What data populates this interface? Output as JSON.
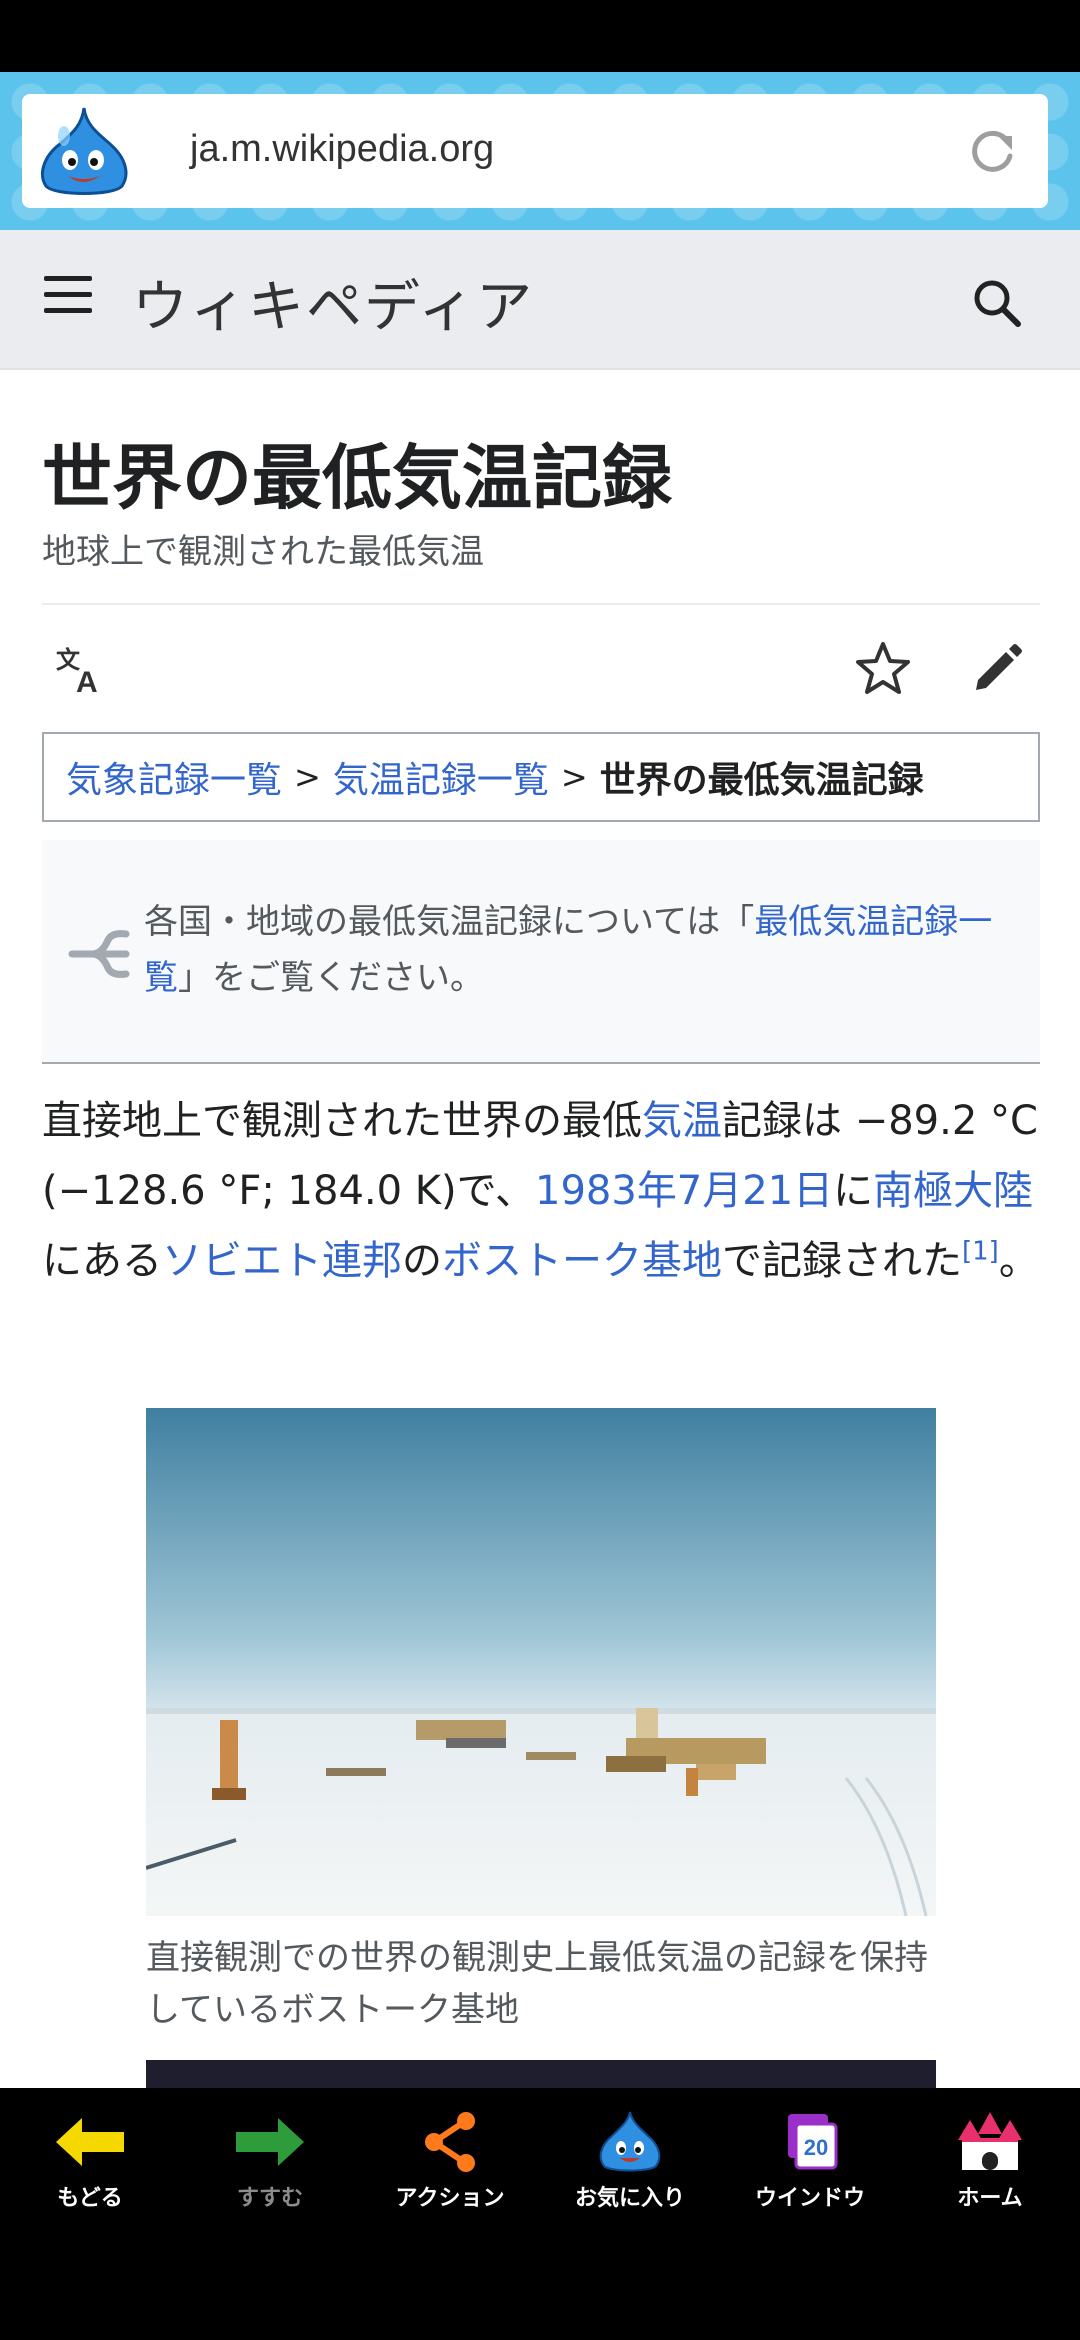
{
  "browser": {
    "url": "ja.m.wikipedia.org"
  },
  "header": {
    "wordmark": "ウィキペディア"
  },
  "page": {
    "title": "世界の最低気温記録",
    "subtitle": "地球上で観測された最低気温"
  },
  "breadcrumb": {
    "items": [
      "気象記録一覧",
      "気温記録一覧"
    ],
    "separator": ">",
    "current": "世界の最低気温記録"
  },
  "hatnote": {
    "pre": "各国・地域の最低気温記録については「",
    "link": "最低気温記録一覧",
    "post": "」をご覧ください。"
  },
  "paragraph": {
    "t1": "直接地上で観測された世界の最低",
    "l1": "気温",
    "t2": "記録は −89.2 °C (−128.6 °F; 184.0 K)で、",
    "l2": "1983年7月21日",
    "t3": "に",
    "l3": "南極大陸",
    "t4": "にある",
    "l4": "ソビエト連邦",
    "t5": "の",
    "l5": "ボストーク基地",
    "t6": "で記録された",
    "ref": "[1]",
    "t7": "。"
  },
  "figure": {
    "caption": "直接観測での世界の観測史上最低気温の記録を保持しているボストーク基地"
  },
  "bottom_nav": {
    "items": [
      {
        "label": "もどる",
        "icon": "arrow-left-icon",
        "color": "#f5d800"
      },
      {
        "label": "すすむ",
        "icon": "arrow-right-icon",
        "color": "#2e9c3a"
      },
      {
        "label": "アクション",
        "icon": "share-icon",
        "color": "#ff7a1a"
      },
      {
        "label": "お気に入り",
        "icon": "slime-icon",
        "color": "#2f8fe0"
      },
      {
        "label": "ウインドウ",
        "icon": "windows-icon",
        "badge": "20",
        "color": "#9b2fc9"
      },
      {
        "label": "ホーム",
        "icon": "castle-icon",
        "color": "#e8306e"
      }
    ]
  },
  "colors": {
    "link": "#3366cc",
    "url_bar_bg": "#5cc3ec",
    "header_bg": "#eaecf0"
  }
}
